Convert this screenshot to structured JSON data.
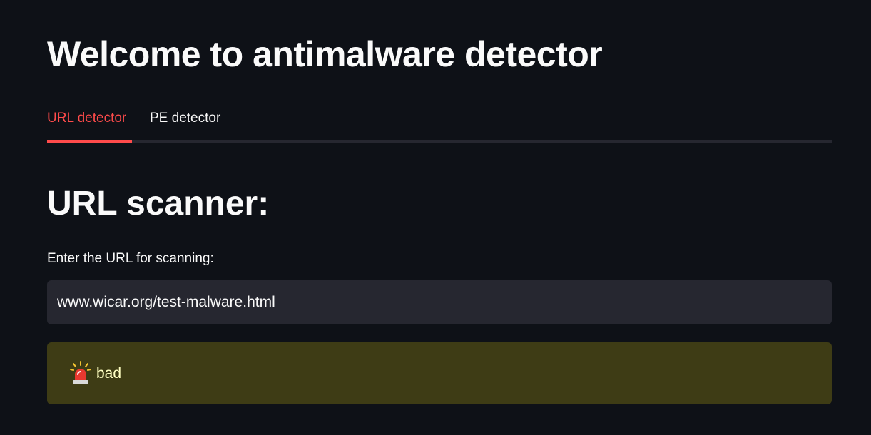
{
  "header": {
    "title": "Welcome to antimalware detector"
  },
  "tabs": [
    {
      "label": "URL detector",
      "active": true
    },
    {
      "label": "PE detector",
      "active": false
    }
  ],
  "url_scanner": {
    "title": "URL scanner:",
    "input_label": "Enter the URL for scanning:",
    "input_value": "www.wicar.org/test-malware.html"
  },
  "result": {
    "icon": "rotating-light-icon",
    "text": "bad"
  },
  "colors": {
    "background": "#0e1117",
    "accent": "#ff4b4b",
    "input_background": "#262730",
    "warning_background": "#3e3c15",
    "warning_text": "#ffffc2"
  }
}
